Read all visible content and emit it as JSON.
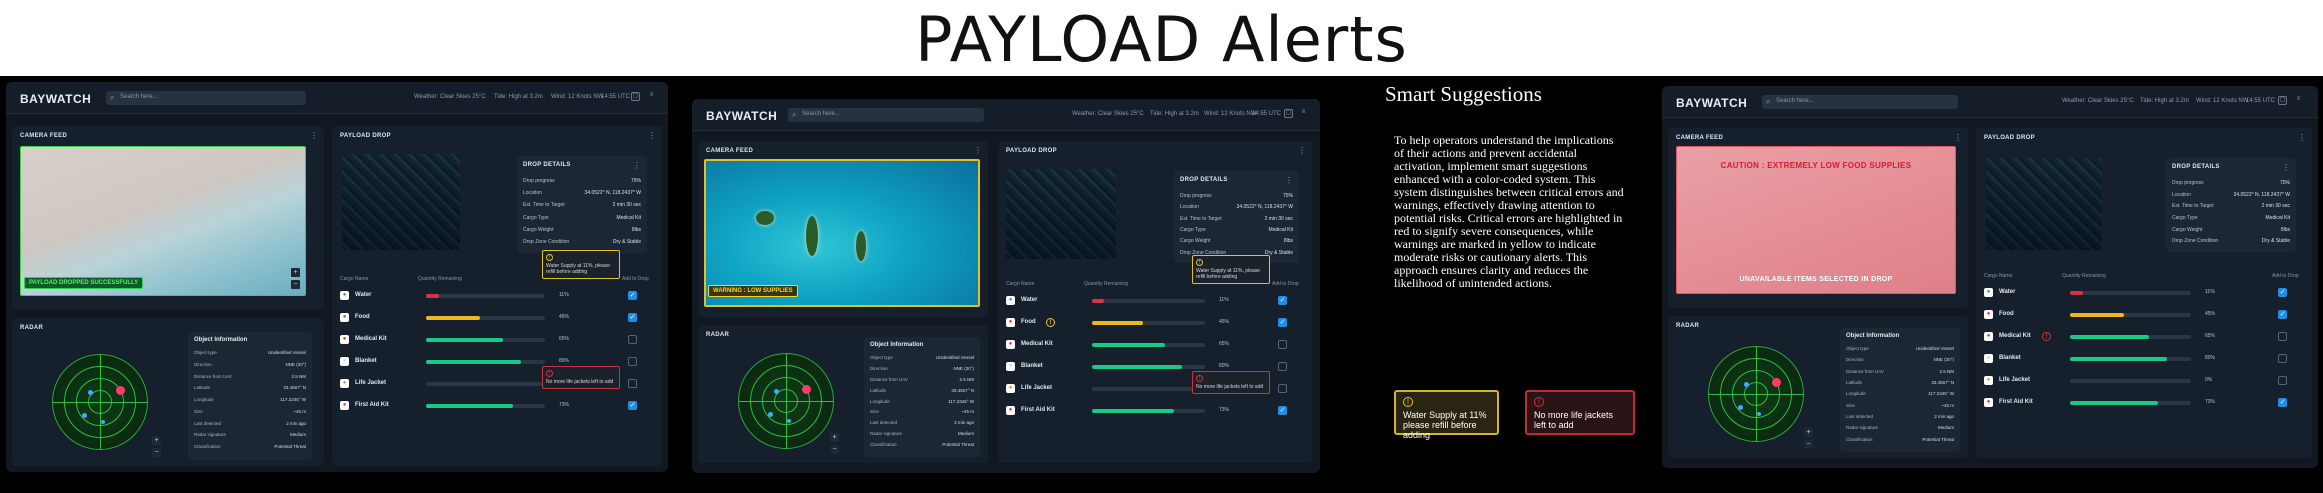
{
  "page_title": "PAYLOAD Alerts",
  "header": {
    "brand": "BAYWATCH",
    "search_placeholder": "Search here...",
    "weather": "Weather: Clear Skies 25°C",
    "tide": "Tide: High at 3.2m",
    "wind": "Wind: 12 Knots NW",
    "time": "14:55 UTC"
  },
  "panels": {
    "camera": "CAMERA FEED",
    "payload": "PAYLOAD DROP",
    "radar": "RADAR",
    "drop_details": "DROP DETAILS",
    "object_info": "Object Information"
  },
  "drop_details": [
    {
      "label": "Drop progress",
      "value": "75%"
    },
    {
      "label": "Location",
      "value": "34.0522° N, 118.2437° W"
    },
    {
      "label": "Est. Time to Target",
      "value": "2 min 30 sec"
    },
    {
      "label": "Cargo Type",
      "value": "Medical Kit"
    },
    {
      "label": "Cargo Weight",
      "value": "8lbs"
    },
    {
      "label": "Drop Zone Condition",
      "value": "Dry & Stable"
    }
  ],
  "supply_columns": {
    "item": "Cargo Name",
    "qty": "Quantity Remaining",
    "add": "Add to Drop"
  },
  "supplies": [
    {
      "name": "Water",
      "icon": "water-icon",
      "pct": "11%",
      "fill": 0.11,
      "color": "#e0303b",
      "checked": true,
      "icon_color": "#3a86d8"
    },
    {
      "name": "Food",
      "icon": "food-icon",
      "pct": "45%",
      "fill": 0.45,
      "color": "#f0b81c",
      "checked": true,
      "icon_color": "#e0303b"
    },
    {
      "name": "Medical Kit",
      "icon": "medical-kit-icon",
      "pct": "65%",
      "fill": 0.65,
      "color": "#19c98a",
      "checked": false,
      "icon_color": "#e03540"
    },
    {
      "name": "Blanket",
      "icon": "blanket-icon",
      "pct": "80%",
      "fill": 0.8,
      "color": "#19c98a",
      "checked": false,
      "icon_color": "#cfd6e0"
    },
    {
      "name": "Life Jacket",
      "icon": "life-jacket-icon",
      "pct": "0%",
      "fill": 0.0,
      "color": "#19c98a",
      "checked": false,
      "icon_color": "#f08a20"
    },
    {
      "name": "First Aid Kit",
      "icon": "first-aid-kit-icon",
      "pct": "73%",
      "fill": 0.73,
      "color": "#19c98a",
      "checked": true,
      "icon_color": "#e03540"
    }
  ],
  "object_info": [
    {
      "label": "Object type",
      "value": "Unidentified Vessel"
    },
    {
      "label": "Direction",
      "value": "NNE (30°)"
    },
    {
      "label": "Distance from UAV",
      "value": "2.5 NM"
    },
    {
      "label": "Latitude",
      "value": "33.4567° N"
    },
    {
      "label": "Longitude",
      "value": "117.2345° W"
    },
    {
      "label": "Size",
      "value": "~45 m"
    },
    {
      "label": "Last detected",
      "value": "2 min ago"
    },
    {
      "label": "Radar signature",
      "value": "Medium"
    },
    {
      "label": "Classification",
      "value": "Potential Threat"
    }
  ],
  "alerts": {
    "success": "PAYLOAD DROPPED SUCCESSFULLY",
    "warning": "WARNING : LOW SUPPLIES",
    "caution": "CAUTION : EXTREMELY LOW FOOD SUPPLIES",
    "unavailable": "UNAVAILABLE ITEMS SELECTED IN DROP",
    "tip_water": "Water Supply at 11%, please refill before adding",
    "tip_jacket": "No more life jackets left to add"
  },
  "smart": {
    "heading": "Smart Suggestions",
    "body": "To help operators understand the implications of their actions and prevent accidental activation, implement smart suggestions enhanced with a color-coded system. This system distinguishes between critical errors and warnings, effectively drawing attention to potential risks. Critical errors are highlighted in red to signify severe consequences, while warnings are marked in yellow to indicate moderate risks or cautionary alerts. This approach ensures clarity and reduces the likelihood of unintended actions.",
    "example_warning": "Water Supply at 11% please refill before adding",
    "example_error": "No more life jackets left to add"
  },
  "colors": {
    "accent": "#1f8fe6",
    "critical": "#c8333f",
    "warning": "#e0c12a",
    "success": "#2ad34c"
  }
}
